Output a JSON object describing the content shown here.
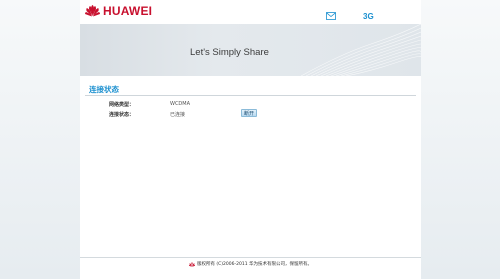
{
  "header": {
    "brand": "HUAWEI",
    "network_type": "3G",
    "accent": "#c8102e",
    "mail_icon": "mail-icon"
  },
  "banner": {
    "slogan": "Let's Simply Share"
  },
  "section": {
    "title": "连接状态"
  },
  "rows": [
    {
      "label": "网络类型：",
      "value": "WCDMA"
    },
    {
      "label": "连接状态：",
      "value": "已连接"
    }
  ],
  "actions": {
    "disconnect_label": "断开"
  },
  "footer": {
    "copyright": "版权所有 (C)2006-2011 华为技术有限公司，保留所有。"
  },
  "colors": {
    "brand_red": "#c8102e",
    "link_blue": "#1a8fcf"
  }
}
